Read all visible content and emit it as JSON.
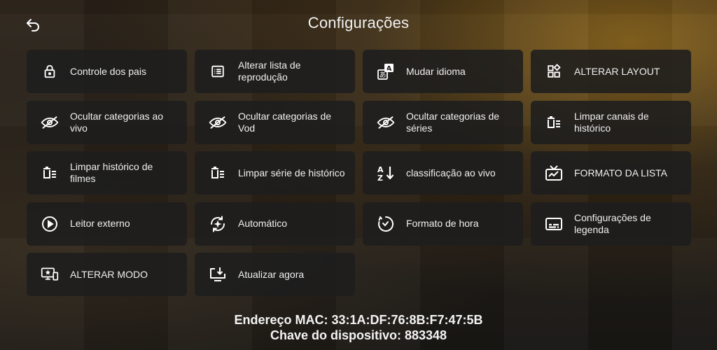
{
  "header": {
    "title": "Configurações",
    "back_icon": "back-arrow-icon"
  },
  "tiles": [
    {
      "label": "Controle dos pais",
      "icon": "lock-icon"
    },
    {
      "label": "Alterar lista de reprodução",
      "icon": "list-icon"
    },
    {
      "label": "Mudar idioma",
      "icon": "translate-icon"
    },
    {
      "label": "ALTERAR LAYOUT",
      "icon": "layout-grid-icon"
    },
    {
      "label": "Ocultar categorias ao vivo",
      "icon": "eye-off-icon"
    },
    {
      "label": "Ocultar categorias de Vod",
      "icon": "eye-off-icon"
    },
    {
      "label": "Ocultar categorias de séries",
      "icon": "eye-off-icon"
    },
    {
      "label": "Limpar canais de histórico",
      "icon": "clear-list-icon"
    },
    {
      "label": "Limpar histórico de filmes",
      "icon": "clear-list-icon"
    },
    {
      "label": "Limpar série de histórico",
      "icon": "clear-list-icon"
    },
    {
      "label": "classificação ao vivo",
      "icon": "sort-az-icon"
    },
    {
      "label": "FORMATO DA LISTA",
      "icon": "tv-icon"
    },
    {
      "label": "Leitor externo",
      "icon": "play-circle-icon"
    },
    {
      "label": "Automático",
      "icon": "auto-refresh-icon"
    },
    {
      "label": "Formato de hora",
      "icon": "clock-format-icon"
    },
    {
      "label": "Configurações de legenda",
      "icon": "subtitles-icon"
    },
    {
      "label": "ALTERAR MODO",
      "icon": "devices-icon"
    },
    {
      "label": "Atualizar agora",
      "icon": "update-download-icon"
    }
  ],
  "footer": {
    "mac": "Endereço MAC: 33:1A:DF:76:8B:F7:47:5B",
    "device_key": "Chave do dispositivo: 883348"
  },
  "colors": {
    "tile_bg": "#1e1e1e",
    "text": "#f0f0f0",
    "accent_glow": "#d2961e"
  }
}
